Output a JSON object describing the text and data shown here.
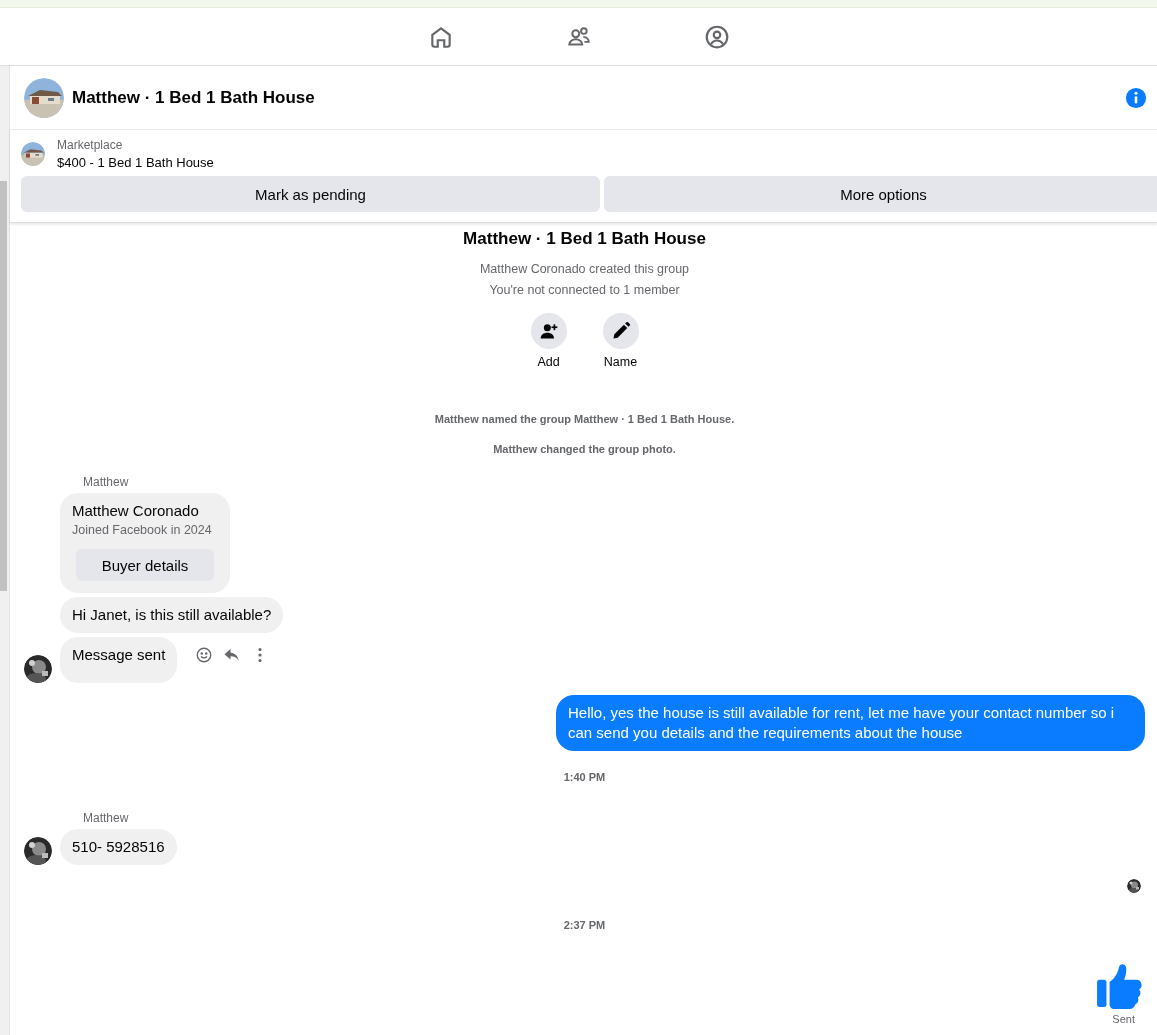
{
  "header": {
    "title": "Matthew · 1 Bed 1 Bath House"
  },
  "listing": {
    "source": "Marketplace",
    "title": "$400 - 1 Bed 1 Bath House",
    "buttons": [
      "Mark as pending",
      "More options"
    ]
  },
  "intro": {
    "title": "Matthew · 1 Bed 1 Bath House",
    "lines": [
      "Matthew Coronado created this group",
      "You're not connected to 1 member"
    ],
    "actions": [
      {
        "label": "Add",
        "kind": "add"
      },
      {
        "label": "Name",
        "kind": "rename"
      }
    ]
  },
  "events": [
    "Matthew named the group Matthew · 1 Bed 1 Bath House.",
    "Matthew changed the group photo."
  ],
  "thread": [
    {
      "kind": "incoming",
      "sender": "Matthew",
      "bubbles": [
        {
          "kind": "profile",
          "name": "Matthew Coronado",
          "detail": "Joined Facebook in 2024",
          "button": "Buyer details"
        },
        {
          "kind": "text",
          "text": "Hi Janet, is this still available?"
        },
        {
          "kind": "text",
          "text": "Message sent",
          "actions": true
        }
      ]
    },
    {
      "kind": "outgoing",
      "text": "Hello, yes the house is still available for rent, let me have your contact number so i can send you details and the requirements about the house"
    },
    {
      "kind": "time",
      "text": "1:40 PM"
    },
    {
      "kind": "incoming",
      "sender": "Matthew",
      "bubbles": [
        {
          "kind": "text",
          "text": "510- 5928516"
        }
      ]
    },
    {
      "kind": "seen"
    },
    {
      "kind": "time",
      "text": "2:37 PM"
    },
    {
      "kind": "like",
      "status": "Sent"
    }
  ]
}
